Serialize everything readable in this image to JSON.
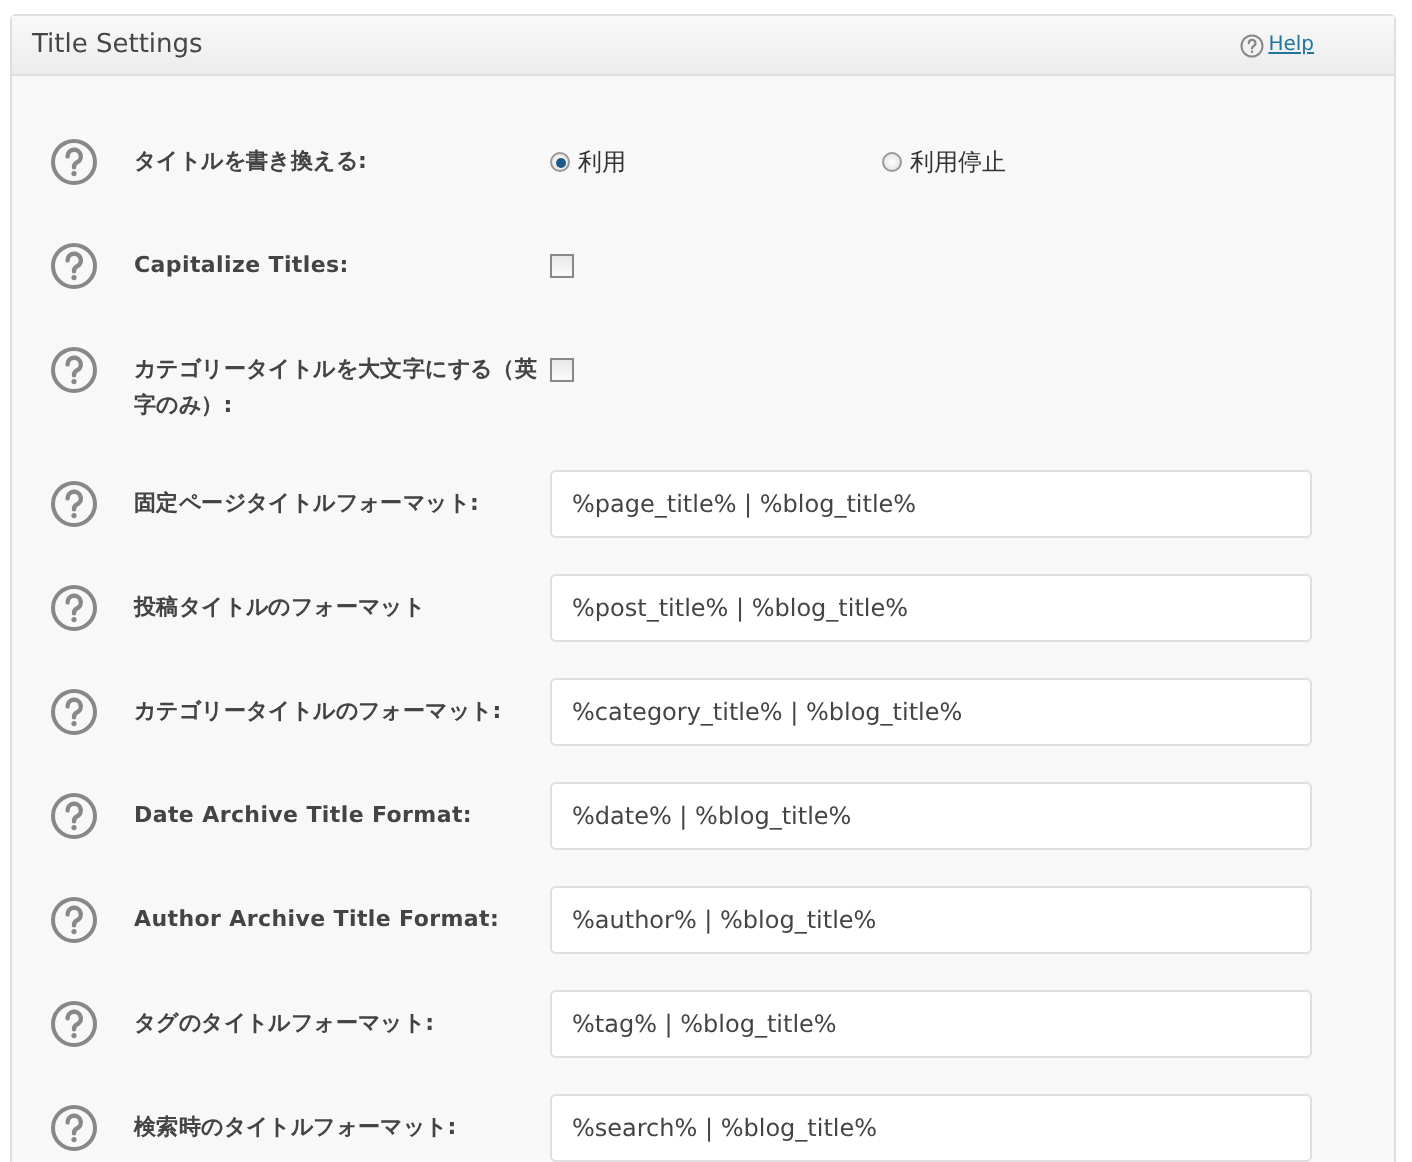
{
  "panel": {
    "title": "Title Settings",
    "help_link": "Help"
  },
  "rows": [
    {
      "kind": "radio",
      "label": "タイトルを書き換える:",
      "options": [
        {
          "label": "利用",
          "selected": true
        },
        {
          "label": "利用停止",
          "selected": false
        }
      ]
    },
    {
      "kind": "checkbox",
      "label": "Capitalize Titles:",
      "checked": false
    },
    {
      "kind": "checkbox",
      "label": "カテゴリータイトルを大文字にする（英字のみ）:",
      "checked": false
    },
    {
      "kind": "text",
      "label": "固定ページタイトルフォーマット:",
      "value": "%page_title% | %blog_title%"
    },
    {
      "kind": "text",
      "label": "投稿タイトルのフォーマット",
      "value": "%post_title% | %blog_title%"
    },
    {
      "kind": "text",
      "label": "カテゴリータイトルのフォーマット:",
      "value": "%category_title% | %blog_title%"
    },
    {
      "kind": "text",
      "label": "Date Archive Title Format:",
      "value": "%date% | %blog_title%"
    },
    {
      "kind": "text",
      "label": "Author Archive Title Format:",
      "value": "%author% | %blog_title%"
    },
    {
      "kind": "text",
      "label": "タグのタイトルフォーマット:",
      "value": "%tag% | %blog_title%"
    },
    {
      "kind": "text",
      "label": "検索時のタイトルフォーマット:",
      "value": "%search% | %blog_title%"
    }
  ]
}
